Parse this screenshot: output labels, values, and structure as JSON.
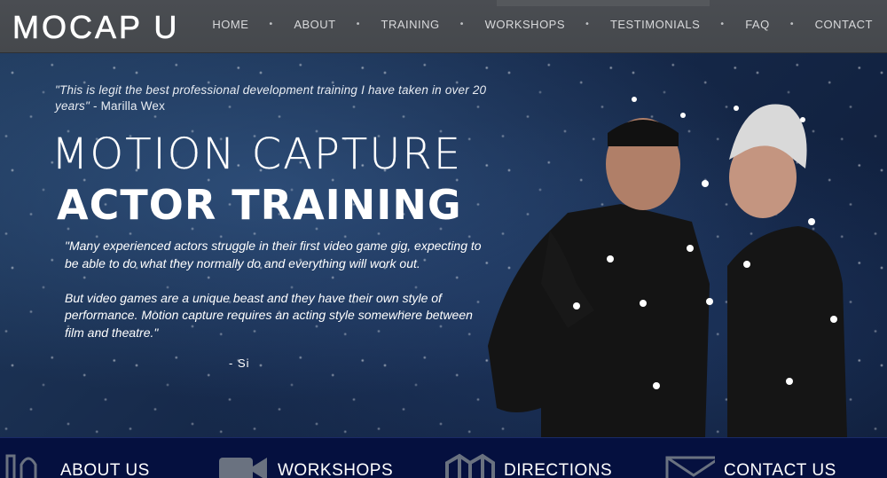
{
  "header": {
    "logo": "MOCAP U",
    "nav": [
      "HOME",
      "ABOUT",
      "TRAINING",
      "WORKSHOPS",
      "TESTIMONIALS",
      "FAQ",
      "CONTACT"
    ],
    "separator": "•"
  },
  "hero": {
    "testimonial_quote": "\"This is legit the best professional development training I have taken in over 20 years\"",
    "testimonial_author": " - Marilla Wex",
    "title_line1": "MOTION CAPTURE",
    "title_line2": "ACTOR TRAINING",
    "quote_p1": "\"Many experienced actors struggle in their first video game gig, expecting to be able to do what they normally do and everything will work out.",
    "quote_p2": "But video games are a unique beast and they have their own style of performance. Motion capture requires an acting style somewhere between film and theatre.\"",
    "signoff": "- Si"
  },
  "bottom_bar": {
    "items": [
      {
        "label": "ABOUT US",
        "icon": "about-icon"
      },
      {
        "label": "WORKSHOPS",
        "icon": "video-camera-icon"
      },
      {
        "label": "DIRECTIONS",
        "icon": "map-icon"
      },
      {
        "label": "CONTACT US",
        "icon": "envelope-icon"
      }
    ]
  },
  "colors": {
    "header_bg": "#46494d",
    "bottom_bar_bg": "#05103f",
    "hero_bg": "#16294a"
  }
}
